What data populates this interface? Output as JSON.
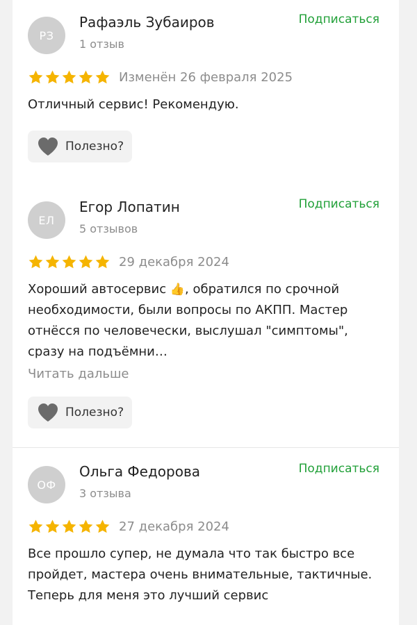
{
  "colors": {
    "accent_green": "#21a038",
    "star_yellow": "#f5b400",
    "avatar_bg": "#cfcfcf",
    "muted_text": "#8c8c8c"
  },
  "reviews": [
    {
      "avatar_initials": "РЗ",
      "author": "Рафаэль Зубаиров",
      "review_count": "1 отзыв",
      "subscribe_label": "Подписаться",
      "rating": 5,
      "date": "Изменён 26 февраля 2025",
      "text": "Отличный сервис! Рекомендую.",
      "helpful_label": "Полезно?"
    },
    {
      "avatar_initials": "ЕЛ",
      "author": "Егор Лопатин",
      "review_count": "5 отзывов",
      "subscribe_label": "Подписаться",
      "rating": 5,
      "date": "29 декабря 2024",
      "text_before_emoji": "Хороший автосервис",
      "text_after_emoji": ", обратился по срочной необходимости, были вопросы по АКПП. Мастер отнёсся по человечески, выслушал \"симптомы\", сразу на подъёмни…",
      "read_more": "Читать дальше",
      "helpful_label": "Полезно?"
    },
    {
      "avatar_initials": "ОФ",
      "author": "Ольга Федорова",
      "review_count": "3 отзыва",
      "subscribe_label": "Подписаться",
      "rating": 5,
      "date": "27 декабря 2024",
      "text": "Все прошло супер, не думала что так быстро все пройдет, мастера очень внимательные, тактичные. Теперь для меня это лучший сервис"
    }
  ]
}
